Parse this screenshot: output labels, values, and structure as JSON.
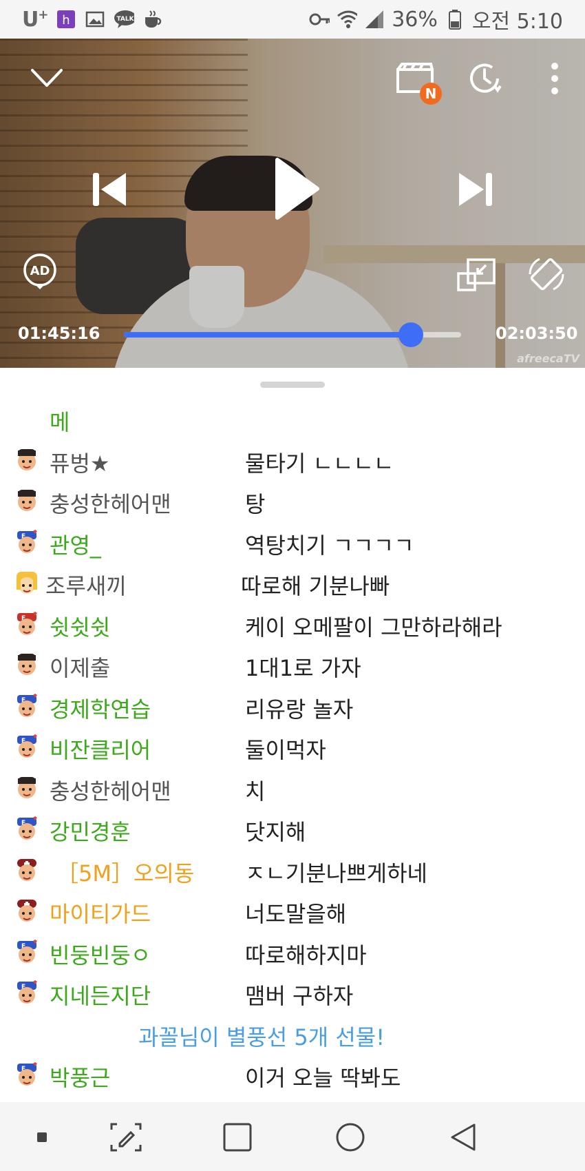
{
  "status_bar": {
    "carrier": "U",
    "carrier_plus": "+",
    "battery": "36%",
    "time": "오전 5:10"
  },
  "player": {
    "current_time": "01:45:16",
    "total_time": "02:03:50",
    "progress_percent": 85,
    "badge": "N",
    "ad_label": "AD",
    "watermark": "afreecaTV"
  },
  "chat": {
    "partial_top": "메",
    "rows": [
      {
        "nick": "퓨벙★",
        "msg": "물타기 ㄴㄴㄴㄴ",
        "style": "gray",
        "avatar": "default-avatar"
      },
      {
        "nick": "충성한헤어맨",
        "msg": "탕",
        "style": "gray",
        "avatar": "default-avatar"
      },
      {
        "nick": "관영_",
        "msg": "역탕치기 ㄱㄱㄱㄱ",
        "style": "green",
        "avatar": "fan-avatar"
      },
      {
        "nick": "조루새끼",
        "msg": "따로해 기분나빠",
        "style": "gray",
        "avatar": "yellow-avatar"
      },
      {
        "nick": "쉿쉿쉿",
        "msg": "케이 오메팔이 그만하라해라",
        "style": "green",
        "avatar": "fan-avatar-red"
      },
      {
        "nick": "이제출",
        "msg": "1대1로 가자",
        "style": "gray",
        "avatar": "default-avatar"
      },
      {
        "nick": "경제학연습",
        "msg": "리유랑 놀자",
        "style": "green",
        "avatar": "fan-avatar"
      },
      {
        "nick": "비잔클리어",
        "msg": "둘이먹자",
        "style": "green",
        "avatar": "fan-avatar"
      },
      {
        "nick": "충성한헤어맨",
        "msg": "치",
        "style": "gray",
        "avatar": "default-avatar"
      },
      {
        "nick": "강민경훈",
        "msg": "닷지해",
        "style": "green",
        "avatar": "fan-avatar"
      },
      {
        "nick": "［5M］오의동",
        "msg": "ㅈㄴ기분나쁘게하네",
        "style": "orange",
        "avatar": "manager-avatar"
      },
      {
        "nick": "마이티가드",
        "msg": "너도말을해",
        "style": "orange",
        "avatar": "manager-avatar"
      },
      {
        "nick": "빈둥빈둥ㅇ",
        "msg": "따로해하지마",
        "style": "green",
        "avatar": "fan-avatar"
      },
      {
        "nick": "지네든지단",
        "msg": "맴버 구하자",
        "style": "green",
        "avatar": "fan-avatar"
      }
    ],
    "notice": "과꼴님이 별풍선 5개 선물!",
    "last_row": {
      "nick": "박풍근",
      "msg": "이거 오늘 딱봐도",
      "style": "green",
      "avatar": "fan-avatar"
    }
  },
  "colors": {
    "accent_blue": "#3f6ef6",
    "nick_green": "#3ca91b",
    "nick_orange": "#f0a01a",
    "notice_blue": "#4a9ee0",
    "badge_orange": "#f26a1e"
  }
}
